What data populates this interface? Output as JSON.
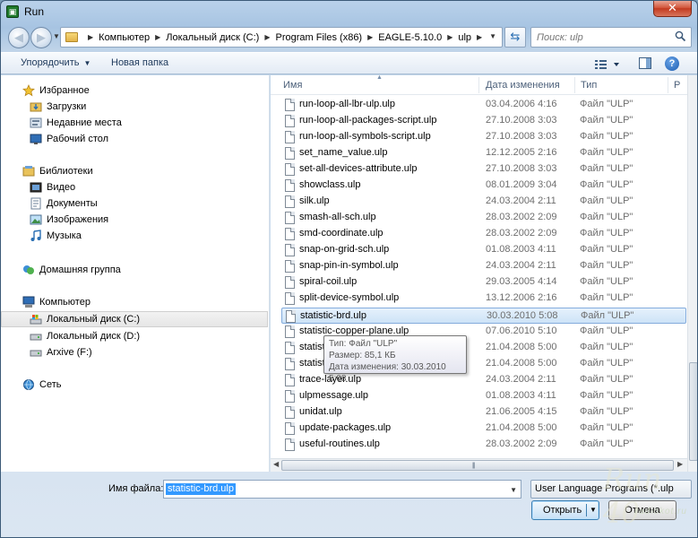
{
  "window": {
    "title": "Run",
    "close_label": "✕"
  },
  "address": {
    "crumbs": [
      "Компьютер",
      "Локальный диск (C:)",
      "Program Files (x86)",
      "EAGLE-5.10.0",
      "ulp"
    ]
  },
  "search": {
    "placeholder": "Поиск: ulp"
  },
  "toolbar": {
    "organize_label": "Упорядочить",
    "new_folder_label": "Новая папка",
    "help_label": "?"
  },
  "sidebar": {
    "items": [
      {
        "label": "Избранное",
        "icon": "star-icon",
        "level": 0
      },
      {
        "label": "Загрузки",
        "icon": "downloads-folder-icon",
        "level": 1
      },
      {
        "label": "Недавние места",
        "icon": "recent-places-icon",
        "level": 1
      },
      {
        "label": "Рабочий стол",
        "icon": "desktop-icon",
        "level": 1
      },
      {
        "label": "Библиотеки",
        "icon": "libraries-icon",
        "level": 0
      },
      {
        "label": "Видео",
        "icon": "video-icon",
        "level": 1
      },
      {
        "label": "Документы",
        "icon": "documents-icon",
        "level": 1
      },
      {
        "label": "Изображения",
        "icon": "pictures-icon",
        "level": 1
      },
      {
        "label": "Музыка",
        "icon": "music-icon",
        "level": 1
      },
      {
        "label": "Домашняя группа",
        "icon": "homegroup-icon",
        "level": 0
      },
      {
        "label": "Компьютер",
        "icon": "computer-icon",
        "level": 0
      },
      {
        "label": "Локальный диск (C:)",
        "icon": "system-drive-icon",
        "level": 1,
        "selected": true
      },
      {
        "label": "Локальный диск (D:)",
        "icon": "drive-icon",
        "level": 1
      },
      {
        "label": "Arxive (F:)",
        "icon": "drive-icon",
        "level": 1
      },
      {
        "label": "Сеть",
        "icon": "network-icon",
        "level": 0
      }
    ]
  },
  "columns": {
    "name": "Имя",
    "date": "Дата изменения",
    "type": "Тип",
    "size": "Р"
  },
  "files": [
    {
      "name": "run-loop-all-lbr-ulp.ulp",
      "date": "03.04.2006 4:16",
      "type": "Файл \"ULP\""
    },
    {
      "name": "run-loop-all-packages-script.ulp",
      "date": "27.10.2008 3:03",
      "type": "Файл \"ULP\""
    },
    {
      "name": "run-loop-all-symbols-script.ulp",
      "date": "27.10.2008 3:03",
      "type": "Файл \"ULP\""
    },
    {
      "name": "set_name_value.ulp",
      "date": "12.12.2005 2:16",
      "type": "Файл \"ULP\""
    },
    {
      "name": "set-all-devices-attribute.ulp",
      "date": "27.10.2008 3:03",
      "type": "Файл \"ULP\""
    },
    {
      "name": "showclass.ulp",
      "date": "08.01.2009 3:04",
      "type": "Файл \"ULP\""
    },
    {
      "name": "silk.ulp",
      "date": "24.03.2004 2:11",
      "type": "Файл \"ULP\""
    },
    {
      "name": "smash-all-sch.ulp",
      "date": "28.03.2002 2:09",
      "type": "Файл \"ULP\""
    },
    {
      "name": "smd-coordinate.ulp",
      "date": "28.03.2002 2:09",
      "type": "Файл \"ULP\""
    },
    {
      "name": "snap-on-grid-sch.ulp",
      "date": "01.08.2003 4:11",
      "type": "Файл \"ULP\""
    },
    {
      "name": "snap-pin-in-symbol.ulp",
      "date": "24.03.2004 2:11",
      "type": "Файл \"ULP\""
    },
    {
      "name": "spiral-coil.ulp",
      "date": "29.03.2005 4:14",
      "type": "Файл \"ULP\""
    },
    {
      "name": "split-device-symbol.ulp",
      "date": "13.12.2006 2:16",
      "type": "Файл \"ULP\""
    },
    {
      "name": "statistic-brd.ulp",
      "date": "30.03.2010 5:08",
      "type": "Файл \"ULP\"",
      "selected": true
    },
    {
      "name": "statistic-copper-plane.ulp",
      "date": "07.06.2010 5:10",
      "type": "Файл \"ULP\""
    },
    {
      "name": "statist",
      "date": "21.04.2008 5:00",
      "type": "Файл \"ULP\""
    },
    {
      "name": "statist",
      "date": "21.04.2008 5:00",
      "type": "Файл \"ULP\""
    },
    {
      "name": "trace-layer.ulp",
      "date": "24.03.2004 2:11",
      "type": "Файл \"ULP\""
    },
    {
      "name": "ulpmessage.ulp",
      "date": "01.08.2003 4:11",
      "type": "Файл \"ULP\""
    },
    {
      "name": "unidat.ulp",
      "date": "21.06.2005 4:15",
      "type": "Файл \"ULP\""
    },
    {
      "name": "update-packages.ulp",
      "date": "21.04.2008 5:00",
      "type": "Файл \"ULP\""
    },
    {
      "name": "useful-routines.ulp",
      "date": "28.03.2002 2:09",
      "type": "Файл \"ULP\""
    }
  ],
  "tooltip": {
    "type": "Тип: Файл \"ULP\"",
    "size": "Размер: 85,1 КБ",
    "date": "Дата изменения: 30.03.2010 5:08"
  },
  "bottom": {
    "filename_label": "Имя файла:",
    "filename_value": "statistic-brd.ulp",
    "filetype_value": "User Language Programs (*.ulp",
    "open_label": "Открыть",
    "cancel_label": "Отмена"
  },
  "watermark": {
    "big": "Run 40",
    "site": "radiokot.ru"
  },
  "colors": {
    "selection": "#cde3f7",
    "selection_border": "#84acdd",
    "text_selection": "#3399ff",
    "close_button": "#c23a20"
  }
}
